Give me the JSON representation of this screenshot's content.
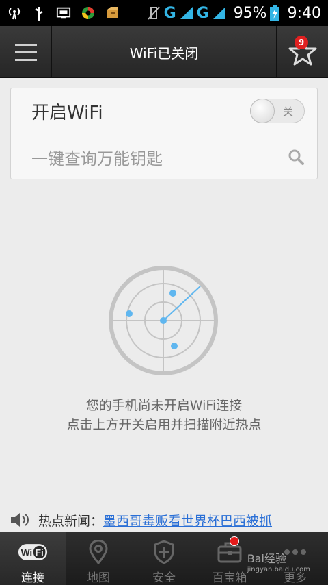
{
  "status_bar": {
    "network_labels": [
      "G",
      "G"
    ],
    "battery_percent": "95%",
    "time": "9:40"
  },
  "header": {
    "title": "WiFi已关闭",
    "favorites_badge": "9"
  },
  "wifi_card": {
    "toggle_label": "开启WiFi",
    "toggle_state_text": "关",
    "search_placeholder": "一键查询万能钥匙"
  },
  "empty_state": {
    "line1": "您的手机尚未开启WiFi连接",
    "line2": "点击上方开关启用并扫描附近热点"
  },
  "news": {
    "label": "热点新闻：",
    "headline": "墨西哥毒贩看世界杯巴西被抓"
  },
  "bottom_nav": {
    "items": [
      {
        "label": "连接",
        "icon": "wifi-icon",
        "active": true
      },
      {
        "label": "地图",
        "icon": "map-pin-icon",
        "active": false
      },
      {
        "label": "安全",
        "icon": "shield-icon",
        "active": false
      },
      {
        "label": "百宝箱",
        "icon": "toolbox-icon",
        "active": false
      },
      {
        "label": "更多",
        "icon": "more-icon",
        "active": false
      }
    ]
  },
  "watermark": {
    "brand": "Bai经验",
    "url": "jingyan.baidu.com"
  },
  "colors": {
    "accent_blue": "#33b5e5",
    "link_blue": "#2a6fd6",
    "badge_red": "#e02020"
  }
}
